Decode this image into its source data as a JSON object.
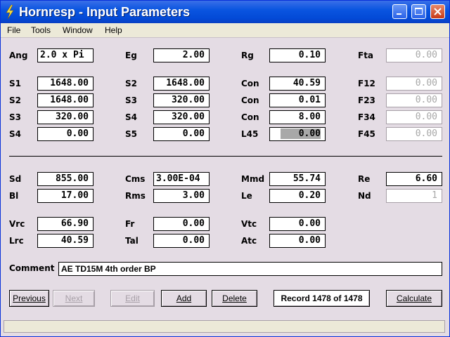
{
  "window": {
    "title": "Hornresp - Input Parameters"
  },
  "menu": [
    "File",
    "Tools",
    "Window",
    "Help"
  ],
  "fields": {
    "ang": {
      "label": "Ang",
      "value": "2.0 x Pi"
    },
    "eg": {
      "label": "Eg",
      "value": "2.00"
    },
    "rg": {
      "label": "Rg",
      "value": "0.10"
    },
    "fta": {
      "label": "Fta",
      "value": "0.00"
    },
    "s1a": {
      "label": "S1",
      "value": "1648.00"
    },
    "s2b": {
      "label": "S2",
      "value": "1648.00"
    },
    "con1": {
      "label": "Con",
      "value": "40.59"
    },
    "f12": {
      "label": "F12",
      "value": "0.00"
    },
    "s2a": {
      "label": "S2",
      "value": "1648.00"
    },
    "s3b": {
      "label": "S3",
      "value": "320.00"
    },
    "con2": {
      "label": "Con",
      "value": "0.01"
    },
    "f23": {
      "label": "F23",
      "value": "0.00"
    },
    "s3a": {
      "label": "S3",
      "value": "320.00"
    },
    "s4b": {
      "label": "S4",
      "value": "320.00"
    },
    "con3": {
      "label": "Con",
      "value": "8.00"
    },
    "f34": {
      "label": "F34",
      "value": "0.00"
    },
    "s4a": {
      "label": "S4",
      "value": "0.00"
    },
    "s5": {
      "label": "S5",
      "value": "0.00"
    },
    "l45": {
      "label": "L45",
      "value": "0.00"
    },
    "f45": {
      "label": "F45",
      "value": "0.00"
    },
    "sd": {
      "label": "Sd",
      "value": "855.00"
    },
    "cms": {
      "label": "Cms",
      "value": "3.00E-04"
    },
    "mmd": {
      "label": "Mmd",
      "value": "55.74"
    },
    "re": {
      "label": "Re",
      "value": "6.60"
    },
    "bl": {
      "label": "Bl",
      "value": "17.00"
    },
    "rms": {
      "label": "Rms",
      "value": "3.00"
    },
    "le": {
      "label": "Le",
      "value": "0.20"
    },
    "nd": {
      "label": "Nd",
      "value": "1"
    },
    "vrc": {
      "label": "Vrc",
      "value": "66.90"
    },
    "fr": {
      "label": "Fr",
      "value": "0.00"
    },
    "vtc": {
      "label": "Vtc",
      "value": "0.00"
    },
    "lrc": {
      "label": "Lrc",
      "value": "40.59"
    },
    "tal": {
      "label": "Tal",
      "value": "0.00"
    },
    "atc": {
      "label": "Atc",
      "value": "0.00"
    }
  },
  "comment": {
    "label": "Comment",
    "value": "AE TD15M 4th order BP"
  },
  "buttons": {
    "previous": "Previous",
    "next": "Next",
    "edit": "Edit",
    "add": "Add",
    "delete": "Delete",
    "record": "Record 1478 of 1478",
    "calculate": "Calculate"
  },
  "colors": {
    "titlebar": "#0349d6",
    "client": "#e4dce4",
    "disabled": "#a8a0a8"
  }
}
